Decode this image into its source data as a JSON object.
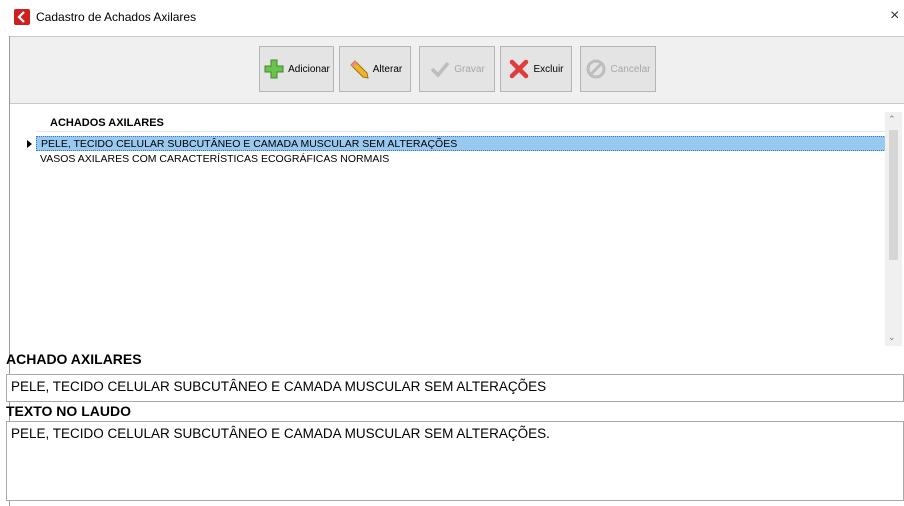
{
  "window": {
    "title": "Cadastro de Achados Axilares",
    "close_symbol": "×",
    "accent_color": "#d0201e"
  },
  "toolbar": {
    "buttons": [
      {
        "label": "Adicionar",
        "icon": "plus-icon",
        "enabled": true
      },
      {
        "label": "Alterar",
        "icon": "pencil-icon",
        "enabled": true
      },
      {
        "label": "Gravar",
        "icon": "checkmark-icon",
        "enabled": false
      },
      {
        "label": "Excluir",
        "icon": "x-icon",
        "enabled": true
      },
      {
        "label": "Cancelar",
        "icon": "cancel-icon",
        "enabled": false
      }
    ]
  },
  "grid": {
    "header": "ACHADOS AXILARES",
    "rows": [
      {
        "text": "PELE, TECIDO CELULAR SUBCUTÂNEO E CAMADA MUSCULAR SEM ALTERAÇÕES",
        "selected": true
      },
      {
        "text": "VASOS AXILARES COM CARACTERÍSTICAS ECOGRÁFICAS NORMAIS",
        "selected": false
      }
    ]
  },
  "form": {
    "achado_label": "ACHADO AXILARES",
    "achado_value": "PELE, TECIDO CELULAR SUBCUTÂNEO E CAMADA MUSCULAR SEM ALTERAÇÕES",
    "texto_label": "TEXTO NO LAUDO",
    "texto_value": "PELE, TECIDO CELULAR SUBCUTÂNEO E CAMADA MUSCULAR SEM ALTERAÇÕES."
  }
}
